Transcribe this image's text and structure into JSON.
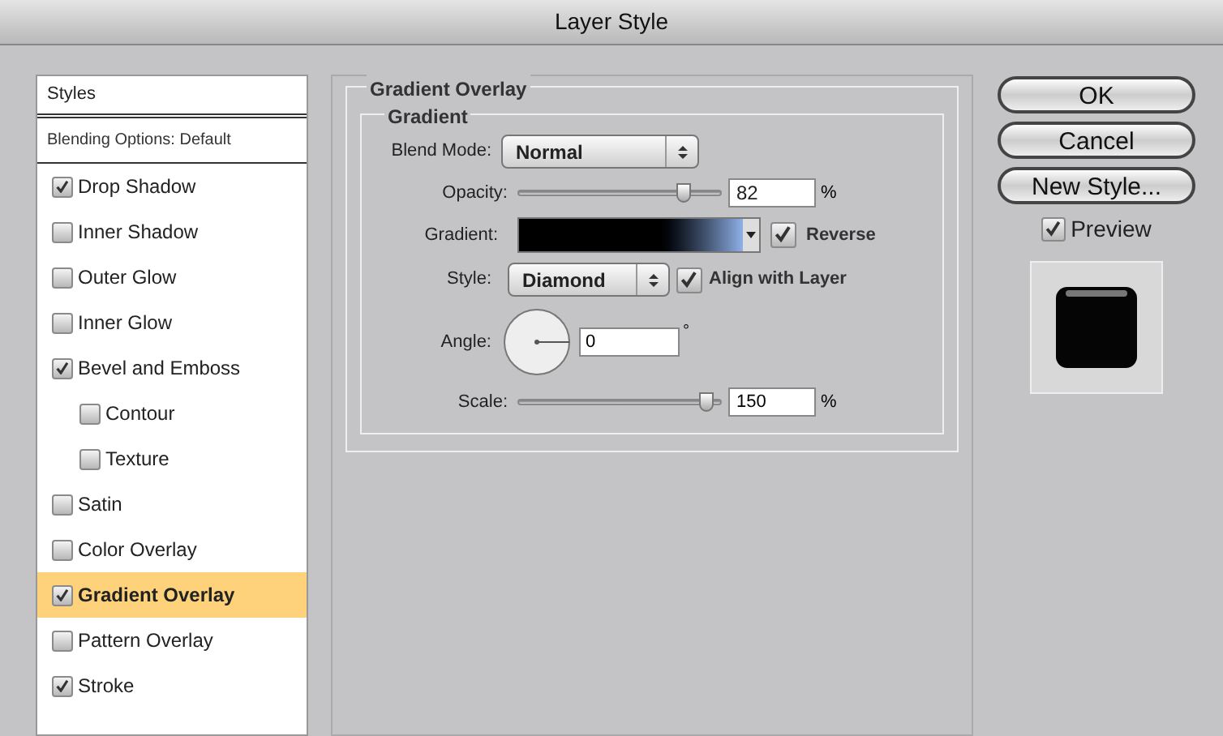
{
  "window": {
    "title": "Layer Style"
  },
  "styles_list": {
    "header": "Styles",
    "blending": "Blending Options: Default",
    "items": [
      {
        "label": "Drop Shadow",
        "checked": true,
        "selected": false
      },
      {
        "label": "Inner Shadow",
        "checked": false,
        "selected": false
      },
      {
        "label": "Outer Glow",
        "checked": false,
        "selected": false
      },
      {
        "label": "Inner Glow",
        "checked": false,
        "selected": false
      },
      {
        "label": "Bevel and Emboss",
        "checked": true,
        "selected": false,
        "children": [
          {
            "label": "Contour",
            "checked": false,
            "selected": false
          },
          {
            "label": "Texture",
            "checked": false,
            "selected": false
          }
        ]
      },
      {
        "label": "Satin",
        "checked": false,
        "selected": false
      },
      {
        "label": "Color Overlay",
        "checked": false,
        "selected": false
      },
      {
        "label": "Gradient Overlay",
        "checked": true,
        "selected": true
      },
      {
        "label": "Pattern Overlay",
        "checked": false,
        "selected": false
      },
      {
        "label": "Stroke",
        "checked": true,
        "selected": false
      }
    ]
  },
  "panel": {
    "title": "Gradient Overlay",
    "group": "Gradient",
    "blend_mode": {
      "label": "Blend Mode:",
      "value": "Normal"
    },
    "opacity": {
      "label": "Opacity:",
      "level": 0.82,
      "value": "82",
      "unit": "%"
    },
    "gradient": {
      "label": "Gradient:",
      "reverse": {
        "label": "Reverse",
        "checked": true
      }
    },
    "style": {
      "label": "Style:",
      "value": "Diamond",
      "align": {
        "label": "Align with Layer",
        "checked": true
      }
    },
    "angle": {
      "label": "Angle:",
      "value": "0",
      "unit": "°"
    },
    "scale": {
      "label": "Scale:",
      "level": 0.93,
      "value": "150",
      "unit": "%"
    }
  },
  "buttons": [
    "OK",
    "Cancel",
    "New Style..."
  ],
  "preview": {
    "label": "Preview",
    "checked": true
  }
}
